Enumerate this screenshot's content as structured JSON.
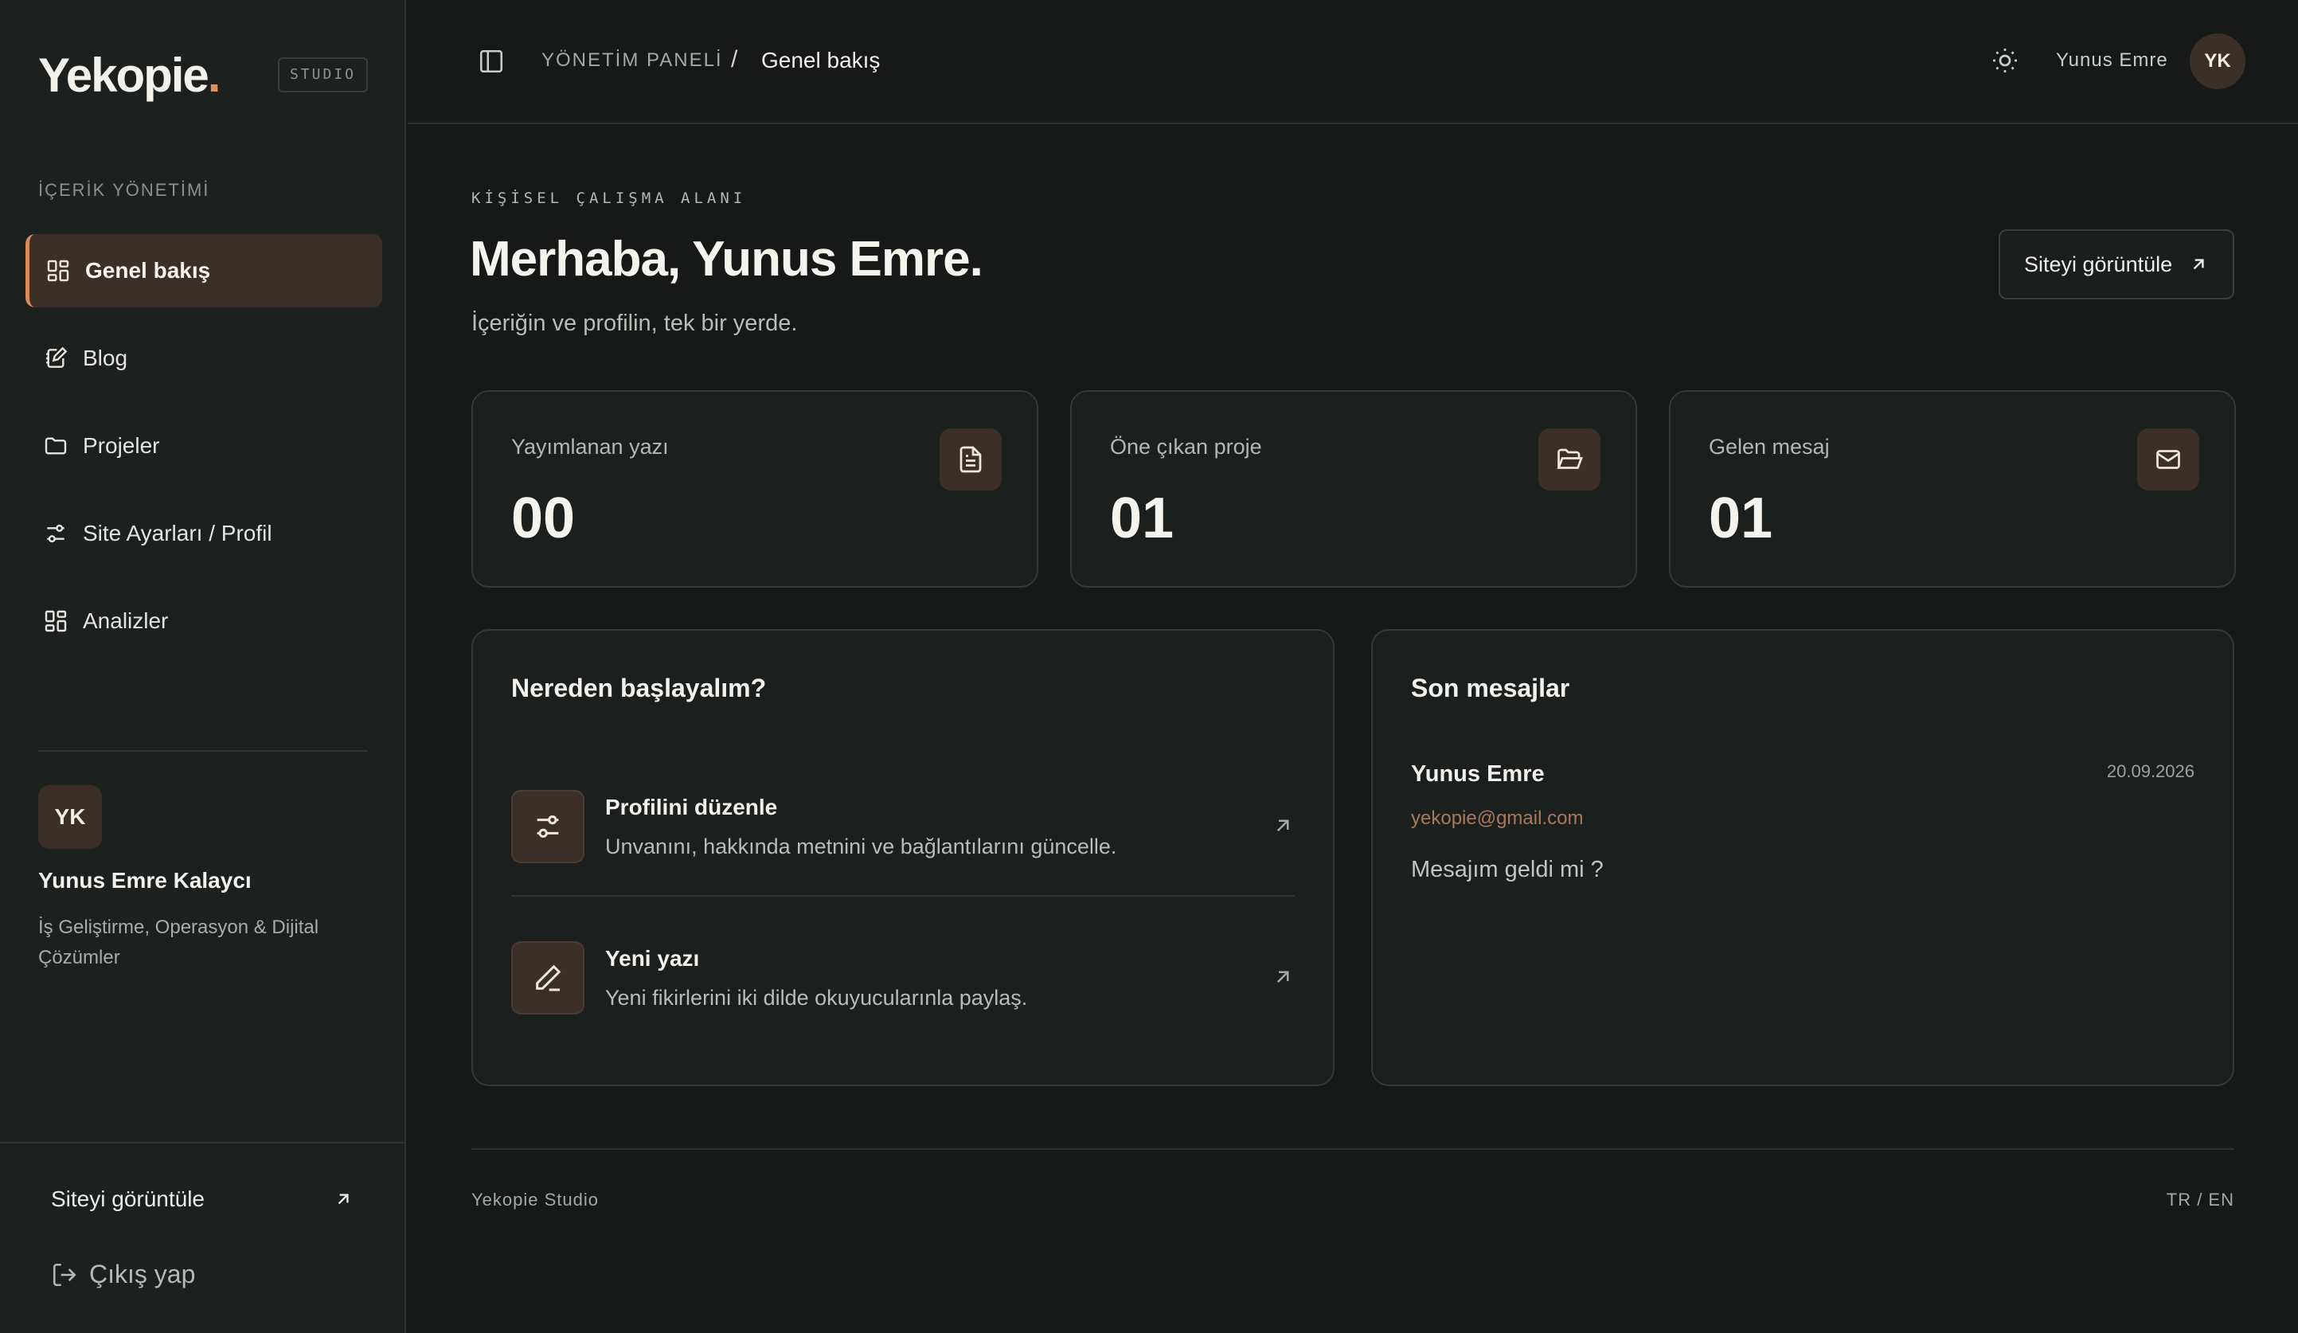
{
  "brand": {
    "logo_text": "Yekopie",
    "logo_dot": ".",
    "badge": "STUDIO",
    "accent": "#e0905f"
  },
  "sidebar": {
    "section_title": "İÇERİK YÖNETİMİ",
    "items": [
      {
        "label": "Genel bakış",
        "icon": "grid-icon",
        "active": true
      },
      {
        "label": "Blog",
        "icon": "notebook-icon",
        "active": false
      },
      {
        "label": "Projeler",
        "icon": "folder-icon",
        "active": false
      },
      {
        "label": "Site Ayarları / Profil",
        "icon": "sliders-icon",
        "active": false
      },
      {
        "label": "Analizler",
        "icon": "grid-icon",
        "active": false
      }
    ],
    "profile": {
      "initials": "YK",
      "name": "Yunus Emre Kalaycı",
      "role": "İş Geliştirme, Operasyon & Dijital Çözümler"
    },
    "view_site": "Siteyi görüntüle",
    "logout": "Çıkış yap"
  },
  "topbar": {
    "breadcrumb_root": "YÖNETİM PANELİ",
    "breadcrumb_sep": "/",
    "breadcrumb_current": "Genel bakış",
    "user_name": "Yunus Emre",
    "user_initials": "YK"
  },
  "main": {
    "eyebrow": "KİŞİSEL ÇALIŞMA ALANI",
    "title": "Merhaba, Yunus Emre.",
    "subtitle": "İçeriğin ve profilin, tek bir yerde.",
    "view_site_button": "Siteyi görüntüle",
    "stats": [
      {
        "label": "Yayımlanan yazı",
        "value": "00",
        "icon": "document-icon"
      },
      {
        "label": "Öne çıkan proje",
        "value": "01",
        "icon": "folder-open-icon"
      },
      {
        "label": "Gelen mesaj",
        "value": "01",
        "icon": "mail-icon"
      }
    ],
    "start_panel": {
      "title": "Nereden başlayalım?",
      "actions": [
        {
          "title": "Profilini düzenle",
          "desc": "Unvanını, hakkında metnini ve bağlantılarını güncelle.",
          "icon": "sliders-icon"
        },
        {
          "title": "Yeni yazı",
          "desc": "Yeni fikirlerini iki dilde okuyucularınla paylaş.",
          "icon": "pen-icon"
        }
      ]
    },
    "messages_panel": {
      "title": "Son mesajlar",
      "messages": [
        {
          "name": "Yunus Emre",
          "date": "20.09.2026",
          "email": "yekopie@gmail.com",
          "body": "Mesajım geldi mi ?"
        }
      ]
    }
  },
  "footer": {
    "left": "Yekopie Studio",
    "right": "TR / EN"
  }
}
